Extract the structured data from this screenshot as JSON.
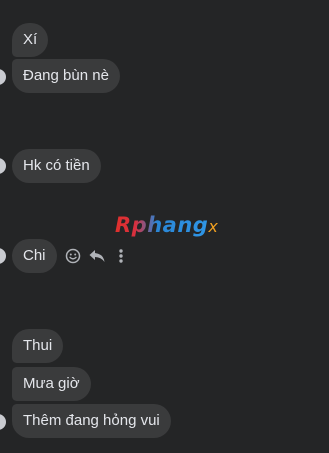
{
  "messages": [
    {
      "text": "Xí"
    },
    {
      "text": "Đang bùn nè"
    },
    {
      "text": "Hk có tiền"
    },
    {
      "text": "Chi"
    },
    {
      "text": "Thui"
    },
    {
      "text": "Mưa giờ"
    },
    {
      "text": "Thêm đang hỏng vui"
    }
  ],
  "watermark": {
    "main": "Rphang",
    "suffix": "x"
  },
  "message_actions": [
    "react-icon",
    "reply-icon",
    "more-icon"
  ],
  "colors": {
    "background": "#242526",
    "bubble": "#3a3b3c",
    "text": "#e4e6eb",
    "icon": "#b0b3b8",
    "avatar": "#c9cbd0"
  }
}
